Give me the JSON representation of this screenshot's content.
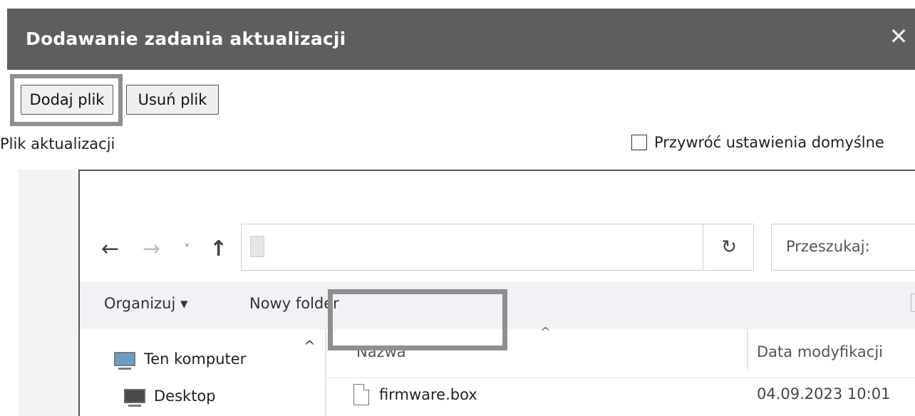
{
  "window": {
    "title": "Dodawanie zadania aktualizacji",
    "close_glyph": "✕"
  },
  "buttons": {
    "add_file": "Dodaj plik",
    "remove_file": "Usuń plik"
  },
  "form": {
    "update_file_label": "Plik aktualizacji",
    "restore_defaults_label": "Przywróć ustawienia domyślne",
    "restore_defaults_checked": false
  },
  "file_dialog": {
    "nav": {
      "back_glyph": "←",
      "forward_glyph": "→",
      "recent_glyph": "˅",
      "up_glyph": "↑",
      "refresh_glyph": "↻"
    },
    "search_placeholder": "Przeszukaj:",
    "toolbar": {
      "organize": "Organizuj ▾",
      "new_folder": "Nowy folder"
    },
    "tree": {
      "items": [
        {
          "label": "Ten komputer",
          "icon": "computer-icon"
        },
        {
          "label": "Desktop",
          "icon": "desktop-icon"
        }
      ],
      "scroll_up_glyph": "^"
    },
    "columns": {
      "name": "Nazwa",
      "date_modified": "Data modyfikacji",
      "sort_glyph": "^"
    },
    "files": [
      {
        "name": "firmware.box",
        "date_modified": "04.09.2023 10:01",
        "icon": "file-icon"
      }
    ]
  }
}
